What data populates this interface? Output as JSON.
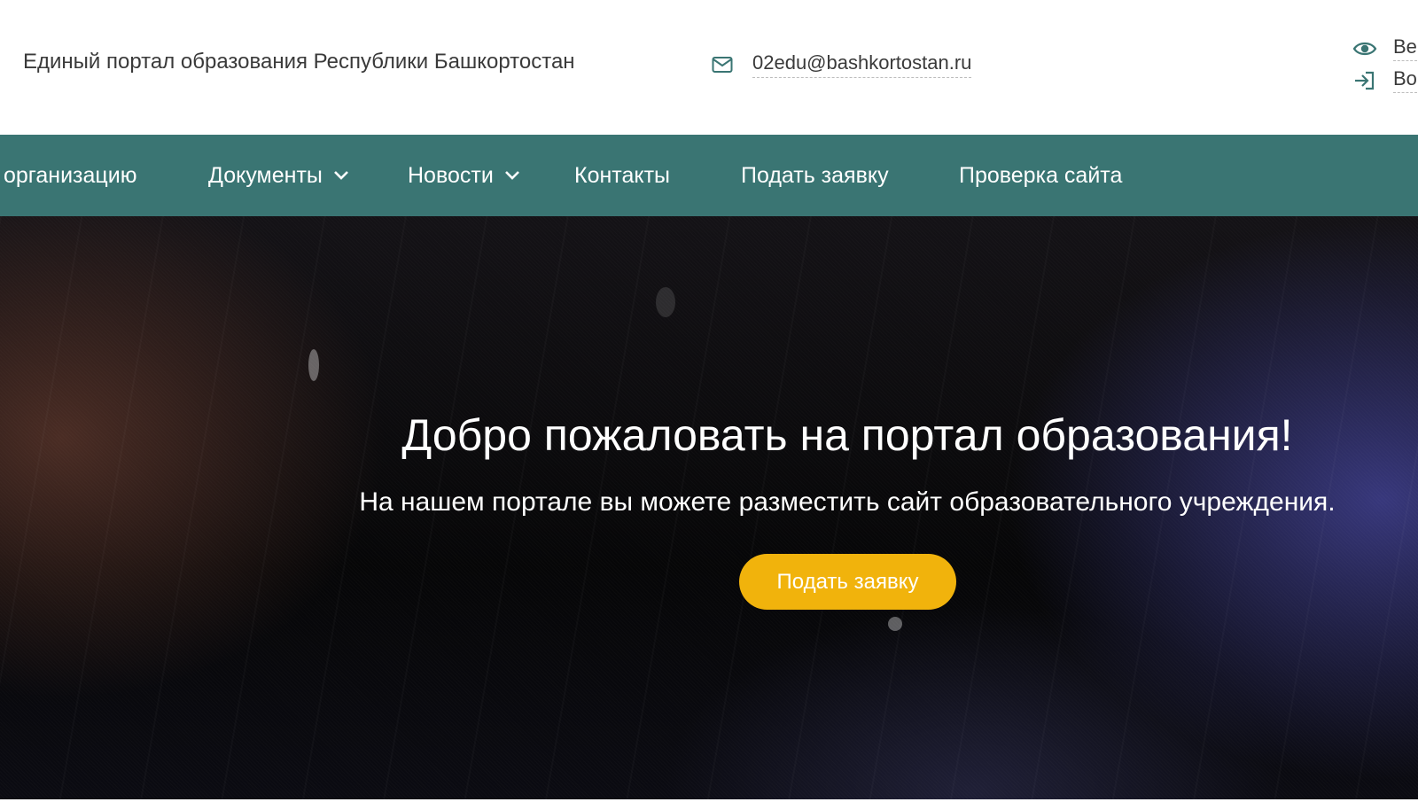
{
  "header": {
    "site_title": "Единый портал образования Республики Башкортостан",
    "email": "02edu@bashkortostan.ru",
    "visually_impaired_label": "Ве",
    "login_label": "Во"
  },
  "nav": {
    "items": [
      {
        "label": "организацию",
        "has_dropdown": false
      },
      {
        "label": "Документы",
        "has_dropdown": true
      },
      {
        "label": "Новости",
        "has_dropdown": true
      },
      {
        "label": "Контакты",
        "has_dropdown": false
      },
      {
        "label": "Подать заявку",
        "has_dropdown": false
      },
      {
        "label": "Проверка сайта",
        "has_dropdown": false
      }
    ]
  },
  "hero": {
    "title": "Добро пожаловать на портал образования!",
    "subtitle": "На нашем портале вы можете разместить сайт образовательного учреждения.",
    "cta_label": "Подать заявку"
  },
  "icons": {
    "email": "envelope-icon",
    "visually_impaired": "eye-icon",
    "login": "sign-in-icon",
    "dropdown": "chevron-down-icon"
  },
  "colors": {
    "nav_bg": "#3a7573",
    "cta_bg": "#f1b30c",
    "text": "#3a3a3a"
  }
}
